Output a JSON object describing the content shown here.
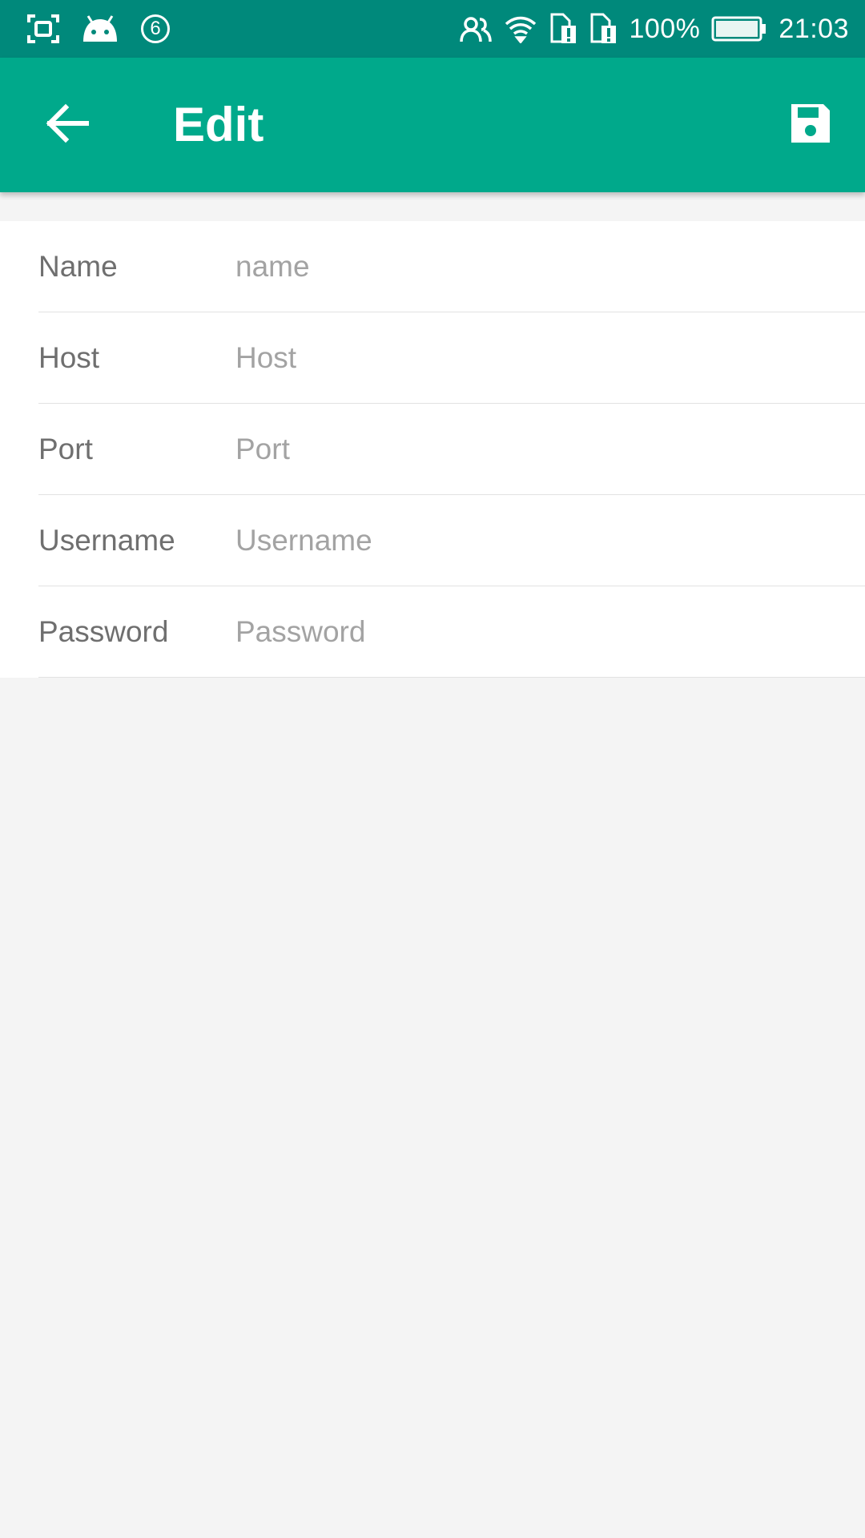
{
  "status_bar": {
    "notification_count": "6",
    "battery": "100%",
    "time": "21:03",
    "icons": [
      "screenshot-icon",
      "android-icon",
      "notification-count-icon",
      "contacts-icon",
      "wifi-icon",
      "sim1-alert-icon",
      "sim2-alert-icon",
      "battery-icon"
    ]
  },
  "app_bar": {
    "title": "Edit",
    "back_icon": "arrow-back-icon",
    "save_icon": "floppy-save-icon"
  },
  "form": {
    "fields": [
      {
        "label": "Name",
        "placeholder": "name",
        "value": ""
      },
      {
        "label": "Host",
        "placeholder": "Host",
        "value": ""
      },
      {
        "label": "Port",
        "placeholder": "Port",
        "value": ""
      },
      {
        "label": "Username",
        "placeholder": "Username",
        "value": ""
      },
      {
        "label": "Password",
        "placeholder": "Password",
        "value": ""
      }
    ]
  },
  "colors": {
    "status_bar": "#00897b",
    "app_bar": "#00a98b",
    "background": "#f4f4f4",
    "label_text": "#6f6f6f",
    "placeholder_text": "#a3a3a3"
  }
}
